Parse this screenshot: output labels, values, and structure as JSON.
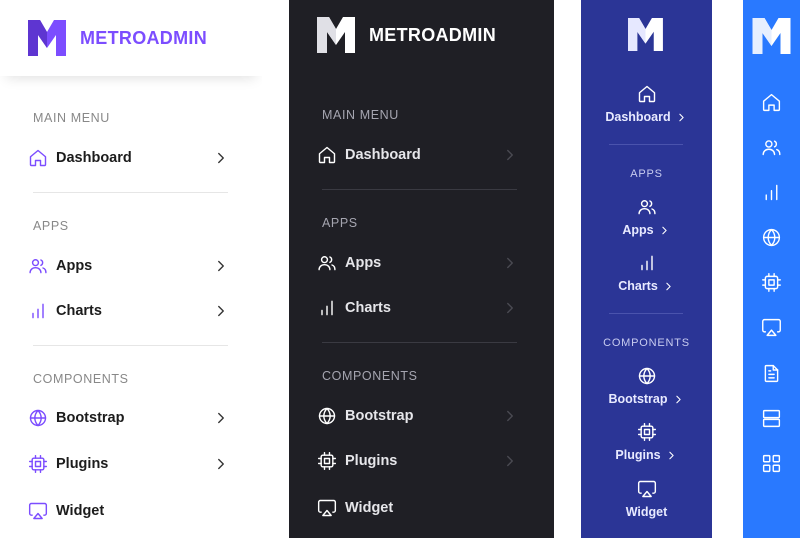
{
  "colors": {
    "accent": "#7c4dff",
    "dark_bg": "#1f1f25",
    "navy_bg": "#2b3596",
    "blue_bg": "#2979ff"
  },
  "brand": {
    "name": "METROADMIN",
    "logo_letter": "M"
  },
  "panel_light": {
    "sections": {
      "main": "MAIN MENU",
      "apps": "APPS",
      "components": "COMPONENTS"
    },
    "items": {
      "dashboard": {
        "label": "Dashboard",
        "icon": "home-icon"
      },
      "apps": {
        "label": "Apps",
        "icon": "users-icon"
      },
      "charts": {
        "label": "Charts",
        "icon": "bar-chart-icon"
      },
      "bootstrap": {
        "label": "Bootstrap",
        "icon": "globe-icon"
      },
      "plugins": {
        "label": "Plugins",
        "icon": "cpu-icon"
      },
      "widget": {
        "label": "Widget",
        "icon": "airplay-icon"
      }
    }
  },
  "panel_dark": {
    "sections": {
      "main": "MAIN MENU",
      "apps": "APPS",
      "components": "COMPONENTS"
    },
    "items": {
      "dashboard": {
        "label": "Dashboard"
      },
      "apps": {
        "label": "Apps"
      },
      "charts": {
        "label": "Charts"
      },
      "bootstrap": {
        "label": "Bootstrap"
      },
      "plugins": {
        "label": "Plugins"
      },
      "widget": {
        "label": "Widget"
      }
    }
  },
  "panel_compact": {
    "sections": {
      "apps": "APPS",
      "components": "COMPONENTS"
    },
    "items": {
      "dashboard": {
        "label": "Dashboard"
      },
      "apps": {
        "label": "Apps"
      },
      "charts": {
        "label": "Charts"
      },
      "bootstrap": {
        "label": "Bootstrap"
      },
      "plugins": {
        "label": "Plugins"
      },
      "widget": {
        "label": "Widget"
      }
    }
  },
  "panel_mini": {
    "icons": [
      "home-icon",
      "users-icon",
      "bar-chart-icon",
      "globe-icon",
      "cpu-icon",
      "airplay-icon",
      "file-text-icon",
      "server-icon",
      "grid-icon"
    ]
  }
}
